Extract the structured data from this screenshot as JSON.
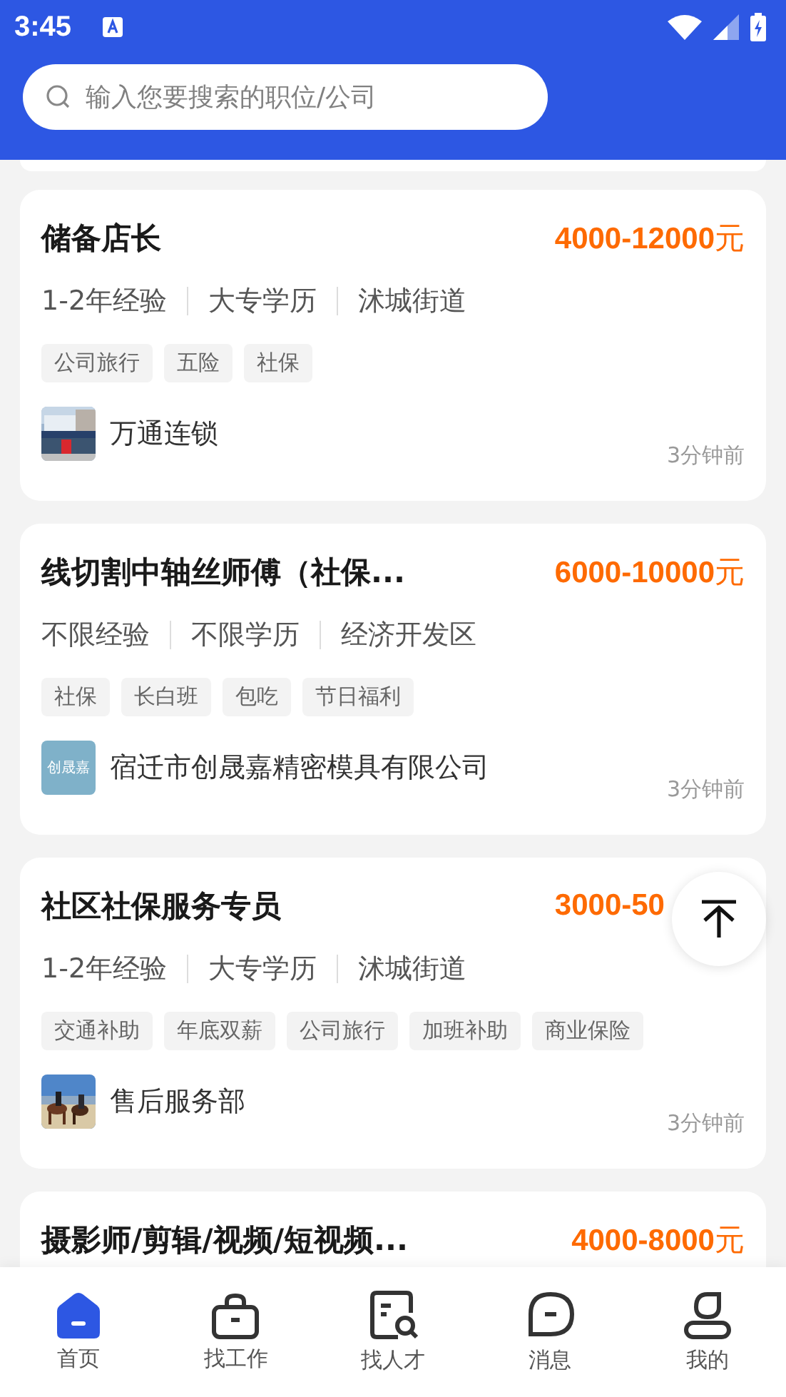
{
  "status_bar": {
    "time": "3:45"
  },
  "search": {
    "placeholder": "输入您要搜索的职位/公司"
  },
  "jobs": [
    {
      "title": "储备店长",
      "salary": "**4000-12000**元",
      "meta": [
        "1-2年经验",
        "大专学历",
        "沭城街道"
      ],
      "tags": [
        "公司旅行",
        "五险",
        "社保"
      ],
      "company": {
        "name": "万通连锁"
      },
      "time": "3分钟前"
    },
    {
      "title": "线切割中轴丝师傅（社保...",
      "salary": "**6000-10000**元",
      "meta": [
        "不限经验",
        "不限学历",
        "经济开发区"
      ],
      "tags": [
        "社保",
        "长白班",
        "包吃",
        "节日福利"
      ],
      "company": {
        "name": "宿迁市创晟嘉精密模具有限公司",
        "logo": {
          "kind": "text",
          "text": "创晟嘉"
        }
      },
      "time": "3分钟前"
    },
    {
      "title": "社区社保服务专员",
      "salary": "**3000-50**",
      "meta": [
        "1-2年经验",
        "大专学历",
        "沭城街道"
      ],
      "tags": [
        "交通补助",
        "年底双薪",
        "公司旅行",
        "加班补助",
        "商业保险"
      ],
      "company": {
        "name": "售后服务部"
      },
      "time": "3分钟前"
    },
    {
      "title": "摄影师/剪辑/视频/短视频...",
      "salary": "**4000-8000**元"
    }
  ],
  "nav": [
    {
      "label": "首页",
      "selected": true
    },
    {
      "label": "找工作",
      "selected": false
    },
    {
      "label": "找人才",
      "selected": false
    },
    {
      "label": "消息",
      "selected": false
    },
    {
      "label": "我的",
      "selected": false
    }
  ]
}
